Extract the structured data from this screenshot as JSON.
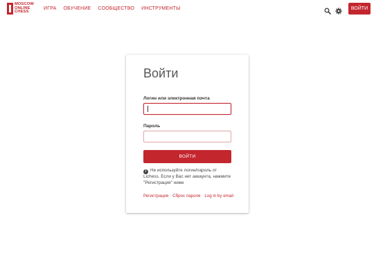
{
  "header": {
    "logo_lines": [
      "MOSCOW",
      "ONLINE",
      "CHESS"
    ],
    "nav": [
      "ИГРА",
      "ОБУЧЕНИЕ",
      "СООБЩЕСТВО",
      "ИНСТРУМЕНТЫ"
    ],
    "login_button": "ВОЙТИ",
    "icons": [
      "search-icon",
      "gear-icon"
    ]
  },
  "login": {
    "title": "Войти",
    "username_label": "Логин или электронная почта",
    "username_value": "",
    "password_label": "Пароль",
    "password_value": "",
    "submit_label": "ВОЙТИ",
    "notice": "Не используйте логин/пароль от Lichess. Если у Вас нет аккаунта, нажмите \"Регистрация\" ниже",
    "links": {
      "register": "Регистрация",
      "reset_password": "Сброс пароля",
      "login_email": "Log in by email"
    }
  },
  "colors": {
    "accent": "#c4262e",
    "background": "#ffffff"
  }
}
